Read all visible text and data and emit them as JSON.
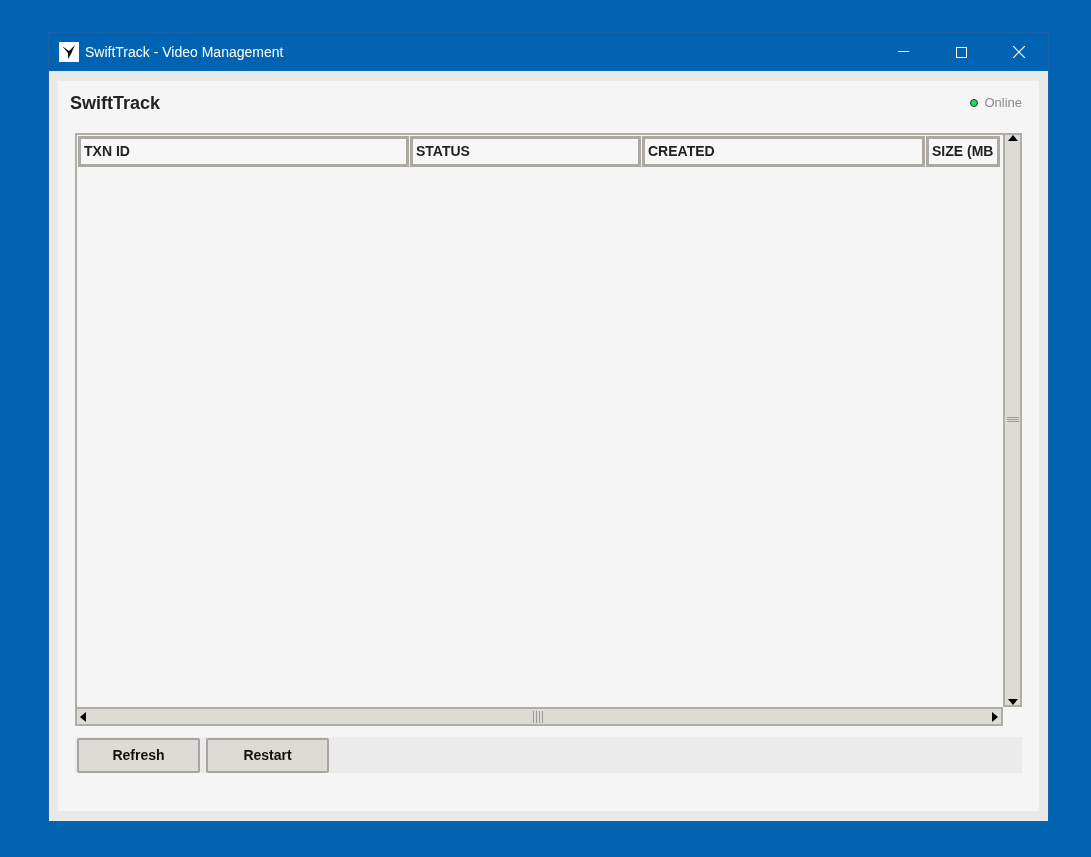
{
  "window": {
    "title": "SwiftTrack - Video Management"
  },
  "header": {
    "title": "SwiftTrack",
    "status": {
      "label": "Online",
      "connected": true
    }
  },
  "table": {
    "columns": [
      "TXN ID",
      "STATUS",
      "CREATED",
      "SIZE (MB"
    ]
  },
  "buttons": [
    "Refresh",
    "Restart"
  ]
}
